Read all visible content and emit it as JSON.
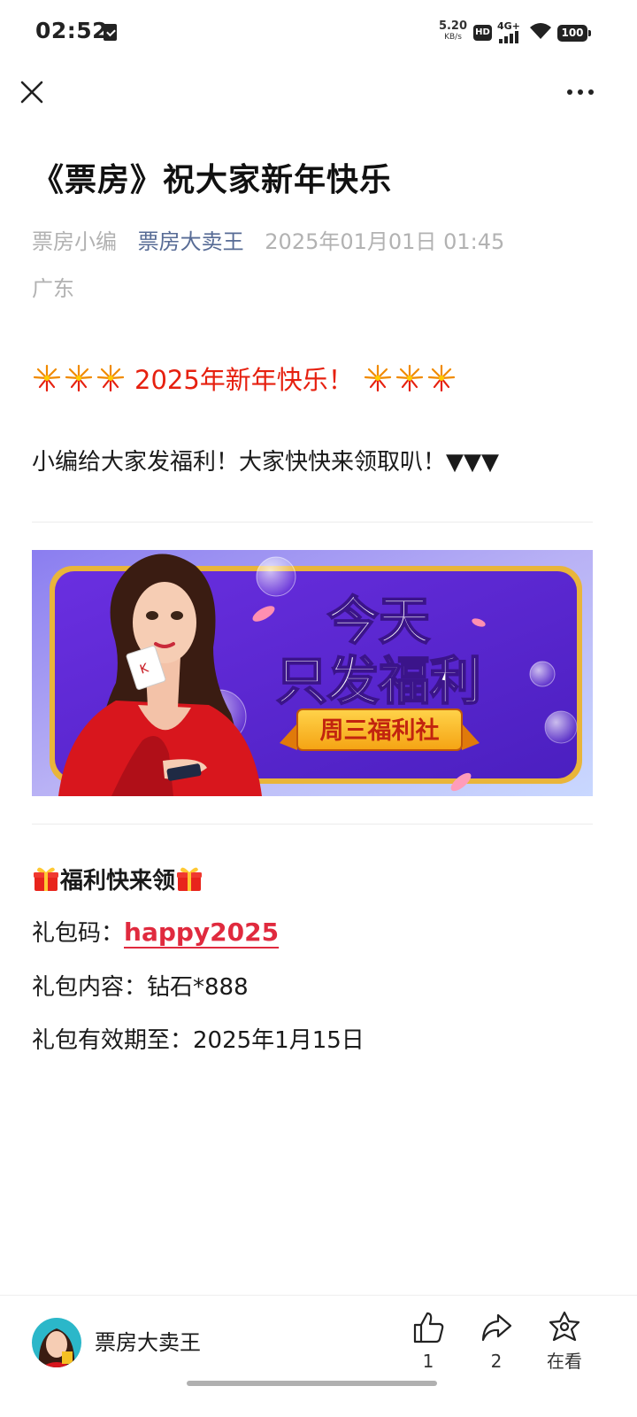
{
  "status_bar": {
    "time": "02:52",
    "net_speed_value": "5.20",
    "net_speed_unit": "KB/s",
    "hd_label": "HD",
    "network_label": "4G+",
    "battery": "100"
  },
  "nav": {
    "close_icon": "close-icon",
    "more_icon": "more-icon"
  },
  "article": {
    "title": "《票房》祝大家新年快乐",
    "author": "票房小编",
    "account": "票房大卖王",
    "date": "2025年01月01日 01:45",
    "region": "广东",
    "greeting": "2025年新年快乐！",
    "intro": "小编给大家发福利！大家快快来领取叭！▼▼▼",
    "banner": {
      "headline_line1": "今天",
      "headline_line2": "只发福利",
      "ribbon": "周三福利社"
    },
    "welfare_title": "福利快来领",
    "code_label": "礼包码：",
    "code_value": "happy2025",
    "content_line": "礼包内容：钻石*888",
    "expiry_line": "礼包有效期至：2025年1月15日"
  },
  "bottom_bar": {
    "account_name": "票房大卖王",
    "like_count": "1",
    "share_count": "2",
    "watching_label": "在看"
  },
  "colors": {
    "accent_red": "#e6200f",
    "link_blue": "#576b95",
    "meta_gray": "#b2b2b2",
    "banner_purple": "#5b2bd4"
  }
}
